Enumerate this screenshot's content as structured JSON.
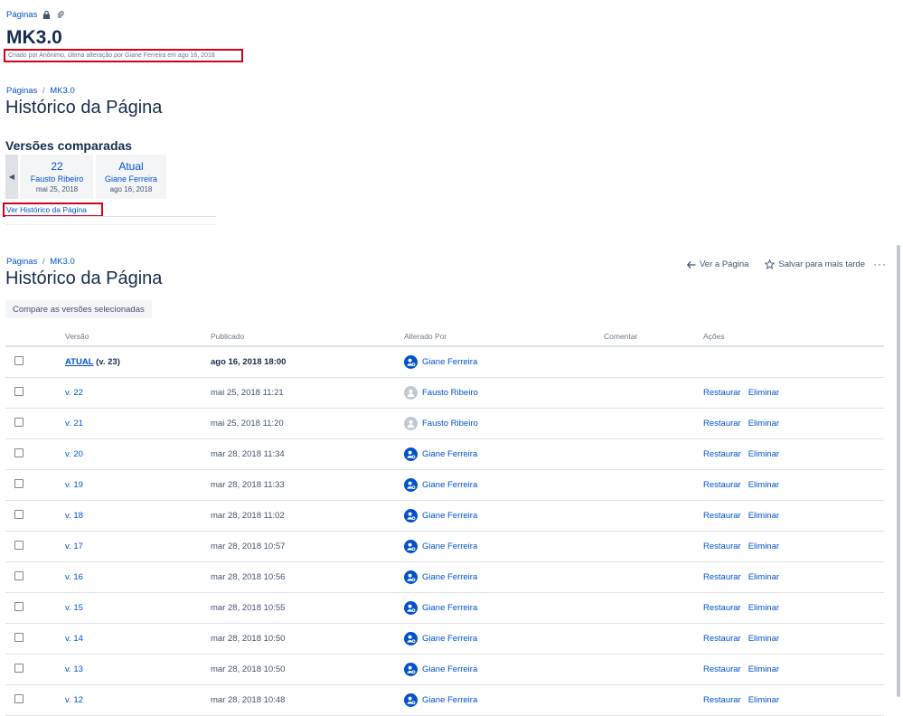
{
  "top": {
    "breadcrumb": "Páginas",
    "title": "MK3.0",
    "byline": "Criado por Anônimo, última alteração por Giane Ferreira em ago 16, 2018"
  },
  "compare_section": {
    "breadcrumb_root": "Páginas",
    "breadcrumb_sep": "/",
    "breadcrumb_page": "MK3.0",
    "title": "Histórico da Página",
    "versions_heading": "Versões comparadas",
    "cards": [
      {
        "version": "22",
        "author": "Fausto Ribeiro",
        "date": "mai 25, 2018"
      },
      {
        "version": "Atual",
        "author": "Giane Ferreira",
        "date": "ago 16, 2018"
      }
    ],
    "view_history_link": "Ver Histórico da Página"
  },
  "history": {
    "breadcrumb_root": "Páginas",
    "breadcrumb_sep": "/",
    "breadcrumb_page": "MK3.0",
    "title": "Histórico da Página",
    "view_page": "Ver a Página",
    "save_later": "Salvar para mais tarde",
    "more": "···",
    "compare_button": "Compare as versões selecionadas",
    "columns": [
      "Versão",
      "Publicado",
      "Alterado Por",
      "Comentar",
      "Ações"
    ],
    "restore_label": "Restaurar",
    "delete_label": "Eliminar",
    "current": {
      "label": "ATUAL",
      "suffix": "(v. 23)",
      "published": "ago 16, 2018 18:00",
      "author": "Giane Ferreira"
    },
    "rows": [
      {
        "version": "v. 22",
        "published": "mai 25, 2018 11:21",
        "author": "Fausto Ribeiro",
        "avatar": "gray"
      },
      {
        "version": "v. 21",
        "published": "mai 25, 2018 11:20",
        "author": "Fausto Ribeiro",
        "avatar": "gray"
      },
      {
        "version": "v. 20",
        "published": "mar 28, 2018 11:34",
        "author": "Giane Ferreira",
        "avatar": "blue"
      },
      {
        "version": "v. 19",
        "published": "mar 28, 2018 11:33",
        "author": "Giane Ferreira",
        "avatar": "blue"
      },
      {
        "version": "v. 18",
        "published": "mar 28, 2018 11:02",
        "author": "Giane Ferreira",
        "avatar": "blue"
      },
      {
        "version": "v. 17",
        "published": "mar 28, 2018 10:57",
        "author": "Giane Ferreira",
        "avatar": "blue"
      },
      {
        "version": "v. 16",
        "published": "mar 28, 2018 10:56",
        "author": "Giane Ferreira",
        "avatar": "blue"
      },
      {
        "version": "v. 15",
        "published": "mar 28, 2018 10:55",
        "author": "Giane Ferreira",
        "avatar": "blue"
      },
      {
        "version": "v. 14",
        "published": "mar 28, 2018 10:50",
        "author": "Giane Ferreira",
        "avatar": "blue"
      },
      {
        "version": "v. 13",
        "published": "mar 28, 2018 10:50",
        "author": "Giane Ferreira",
        "avatar": "blue"
      },
      {
        "version": "v. 12",
        "published": "mar 28, 2018 10:48",
        "author": "Giane Ferreira",
        "avatar": "blue"
      }
    ]
  },
  "colors": {
    "link": "#0052cc",
    "highlight": "#d0021b",
    "text": "#172b4d"
  }
}
